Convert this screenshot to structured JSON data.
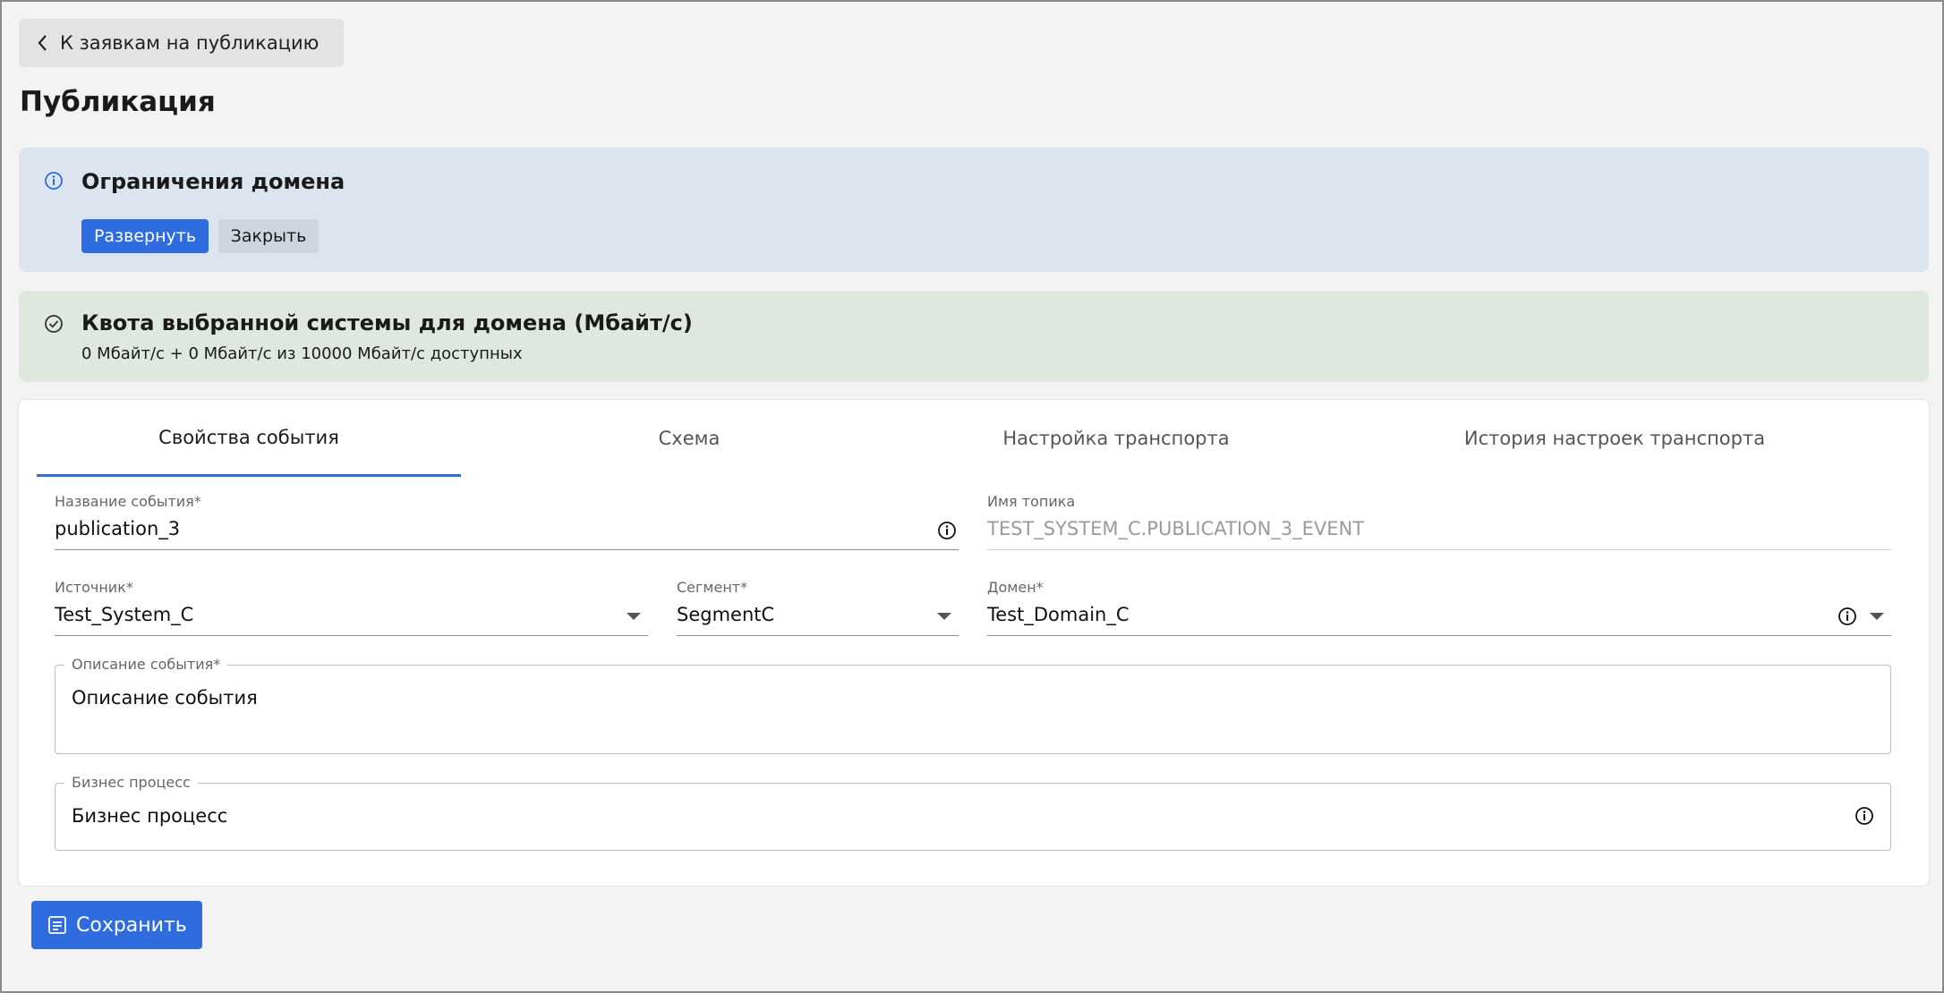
{
  "back_button": {
    "label": "К заявкам на публикацию"
  },
  "page": {
    "title": "Публикация"
  },
  "domain_limits": {
    "title": "Ограничения домена",
    "expand_label": "Развернуть",
    "close_label": "Закрыть"
  },
  "quota": {
    "title": "Квота выбранной системы для домена (Мбайт/с)",
    "text": "0 Мбайт/с + 0 Мбайт/с из 10000 Мбайт/с доступных"
  },
  "tabs": [
    {
      "label": "Свойства события",
      "active": true
    },
    {
      "label": "Схема",
      "active": false
    },
    {
      "label": "Настройка транспорта",
      "active": false
    },
    {
      "label": "История настроек транспорта",
      "active": false
    }
  ],
  "form": {
    "event_name": {
      "label": "Название события",
      "required_mark": "*",
      "value": "publication_3"
    },
    "topic_name": {
      "label": "Имя топика",
      "value": "TEST_SYSTEM_C.PUBLICATION_3_EVENT"
    },
    "source": {
      "label": "Источник",
      "required_mark": "*",
      "value": "Test_System_C"
    },
    "segment": {
      "label": "Сегмент",
      "required_mark": "*",
      "value": "SegmentC"
    },
    "domain": {
      "label": "Домен",
      "required_mark": "*",
      "value": "Test_Domain_C"
    },
    "description": {
      "label": "Описание события",
      "required_mark": "*",
      "value": "Описание события"
    },
    "business_process": {
      "label": "Бизнес процесс",
      "value": "Бизнес процесс"
    }
  },
  "save_button": {
    "label": "Сохранить"
  },
  "colors": {
    "accent": "#2f6ce0",
    "info_bg": "#dce5ef",
    "success_bg": "#dfe8de"
  }
}
